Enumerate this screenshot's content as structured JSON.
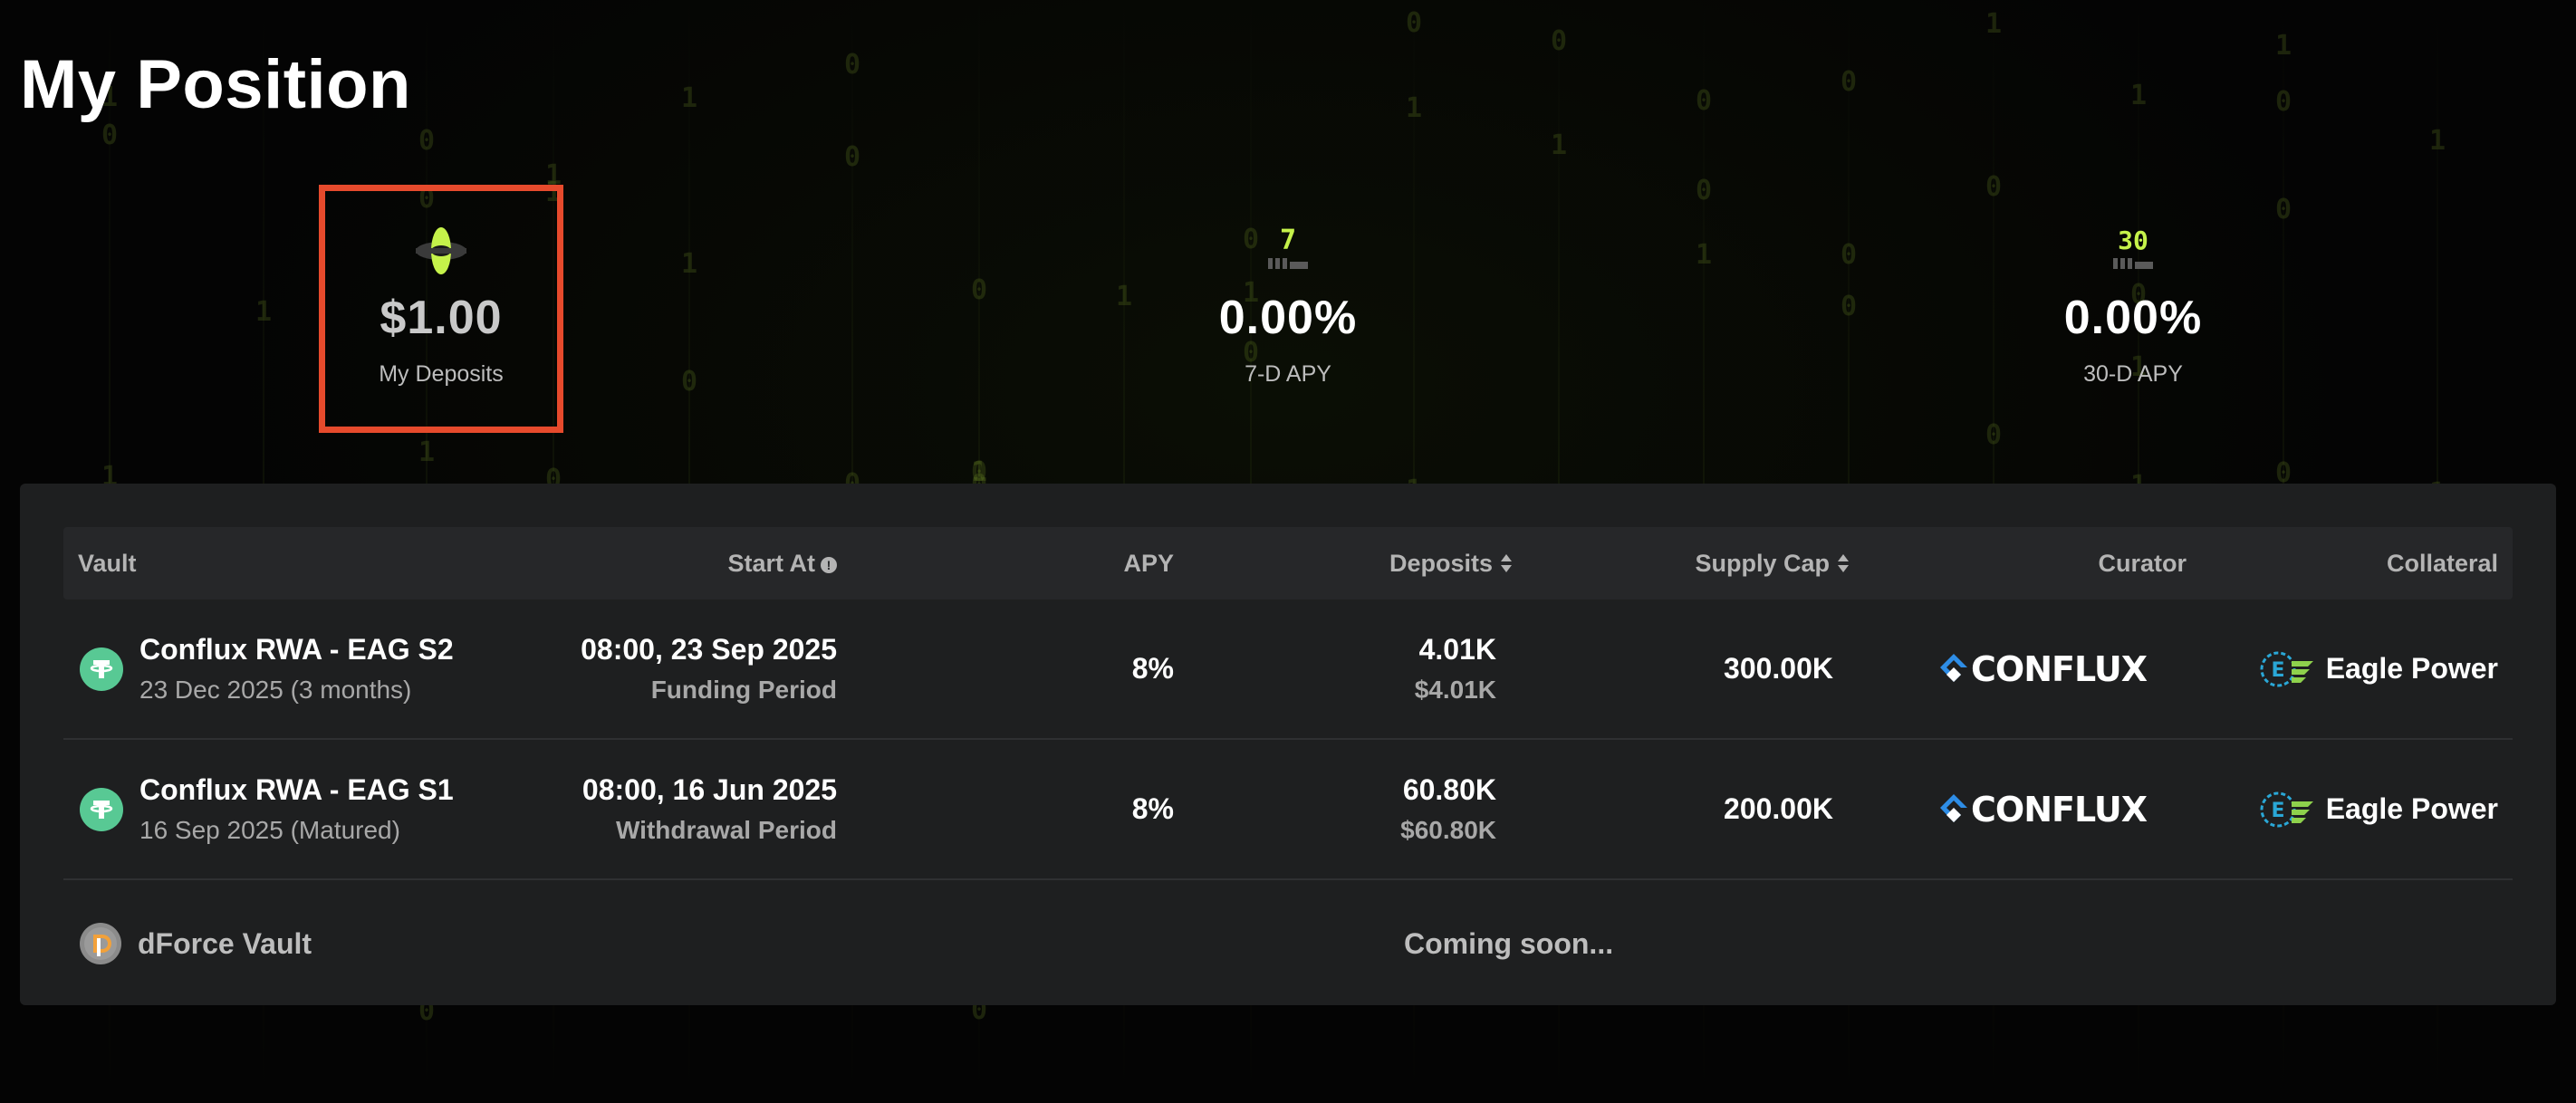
{
  "page": {
    "title": "My Position"
  },
  "stats": [
    {
      "id": "deposits",
      "value": "$1.00",
      "label": "My Deposits",
      "icon": "dforce-orbit-icon",
      "highlighted": true
    },
    {
      "id": "apy7",
      "value": "0.00%",
      "label": "7-D APY",
      "icon": "calendar-7-icon",
      "icon_text": "7"
    },
    {
      "id": "apy30",
      "value": "0.00%",
      "label": "30-D APY",
      "icon": "calendar-30-icon",
      "icon_text": "30"
    }
  ],
  "table": {
    "headers": {
      "vault": "Vault",
      "start_at": "Start At",
      "apy": "APY",
      "deposits": "Deposits",
      "supply_cap": "Supply Cap",
      "curator": "Curator",
      "collateral": "Collateral"
    },
    "rows": [
      {
        "vault_name": "Conflux RWA - EAG S2",
        "vault_sub": "23 Dec 2025 (3 months)",
        "start_at": "08:00, 23 Sep 2025",
        "period": "Funding Period",
        "apy": "8%",
        "deposits": "4.01K",
        "deposits_usd": "$4.01K",
        "supply_cap": "300.00K",
        "curator": "CONFLUX",
        "collateral": "Eagle Power"
      },
      {
        "vault_name": "Conflux RWA - EAG S1",
        "vault_sub": "16 Sep 2025 (Matured)",
        "start_at": "08:00, 16 Jun 2025",
        "period": "Withdrawal Period",
        "apy": "8%",
        "deposits": "60.80K",
        "deposits_usd": "$60.80K",
        "supply_cap": "200.00K",
        "curator": "CONFLUX",
        "collateral": "Eagle Power"
      }
    ],
    "footer_row": {
      "vault_name": "dForce Vault",
      "status": "Coming soon..."
    }
  },
  "colors": {
    "accent_green": "#c5f24a",
    "highlight_border": "#e64a2c",
    "usdt_green": "#58c994",
    "panel_bg": "#1e1f20"
  }
}
